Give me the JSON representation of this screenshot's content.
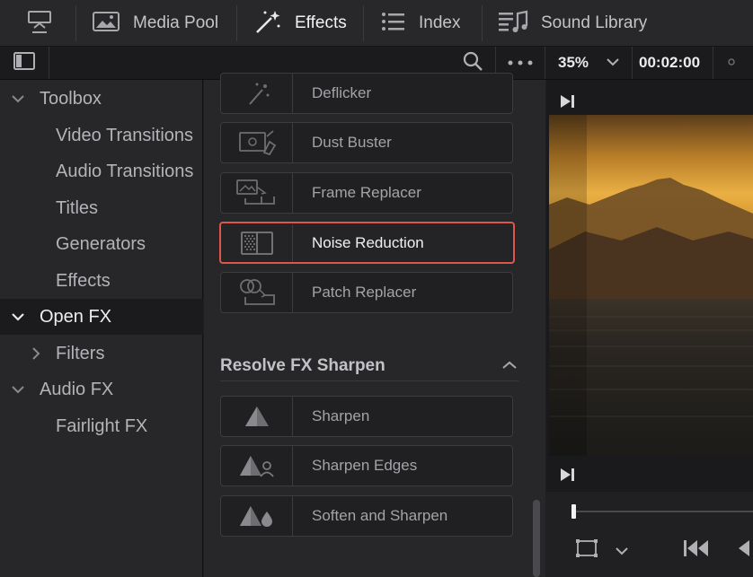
{
  "toolbar": {
    "media_pool": "Media Pool",
    "effects": "Effects",
    "index": "Index",
    "sound_library": "Sound Library"
  },
  "bar2": {
    "zoom": "35%",
    "timecode": "00:02:00"
  },
  "tree": {
    "toolbox": "Toolbox",
    "video_transitions": "Video Transitions",
    "audio_transitions": "Audio Transitions",
    "titles": "Titles",
    "generators": "Generators",
    "effects": "Effects",
    "open_fx": "Open FX",
    "filters": "Filters",
    "audio_fx": "Audio FX",
    "fairlight_fx": "Fairlight FX"
  },
  "list": {
    "items": [
      {
        "label": "Deflicker"
      },
      {
        "label": "Dust Buster"
      },
      {
        "label": "Frame Replacer"
      },
      {
        "label": "Noise Reduction"
      },
      {
        "label": "Patch Replacer"
      }
    ],
    "section_title": "Resolve FX Sharpen",
    "sharpen_items": [
      {
        "label": "Sharpen"
      },
      {
        "label": "Sharpen Edges"
      },
      {
        "label": "Soften and Sharpen"
      }
    ]
  },
  "colors": {
    "selection_outline": "#e0554a",
    "panel_bg": "#27272a"
  }
}
